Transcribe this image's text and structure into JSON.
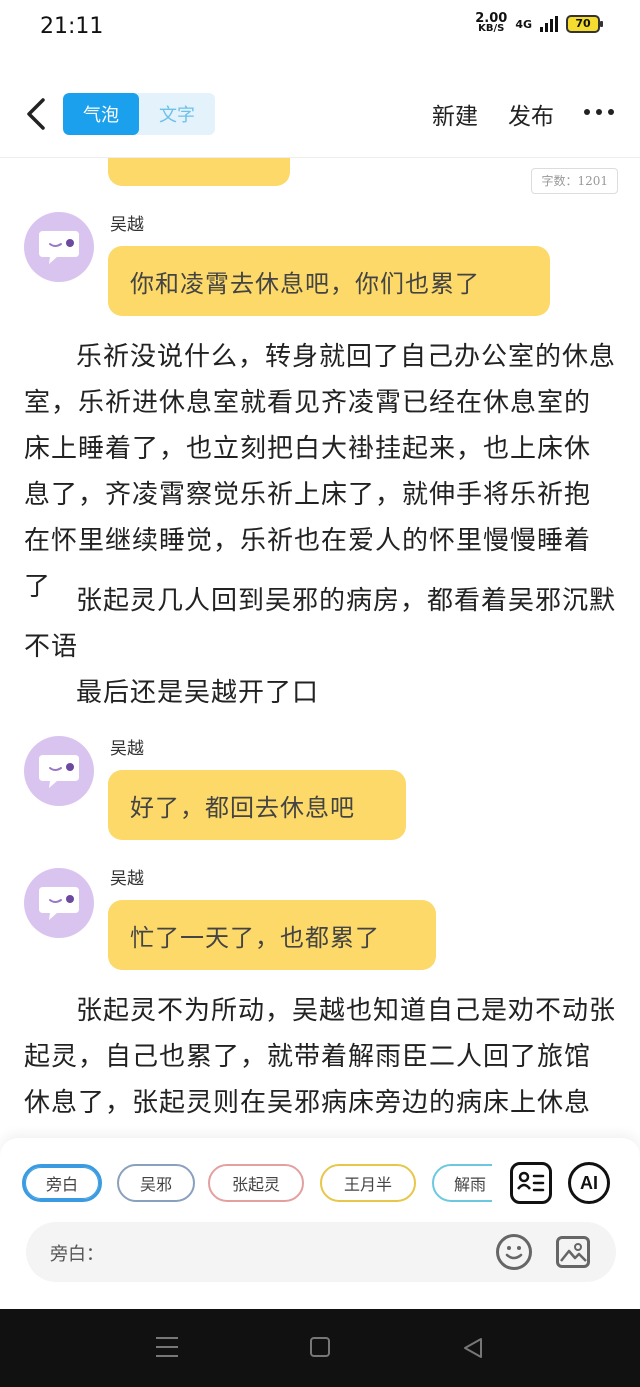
{
  "status_bar": {
    "time": "21:11",
    "net_speed_value": "2.00",
    "net_speed_unit": "KB/S",
    "network_type": "4G",
    "battery": "70"
  },
  "nav": {
    "modes": [
      "气泡",
      "文字"
    ],
    "active_mode": "气泡",
    "new_label": "新建",
    "publish_label": "发布",
    "more_icon": "more-icon"
  },
  "word_count": "字数：1201",
  "messages": [
    {
      "speaker": "吴越",
      "text": "你和凌霄去休息吧，你们也累了"
    },
    {
      "speaker": "吴越",
      "text": "好了，都回去休息吧"
    },
    {
      "speaker": "吴越",
      "text": "忙了一天了，也都累了"
    }
  ],
  "narrations": [
    "乐祈没说什么，转身就回了自己办公室的休息室，乐祈进休息室就看见齐凌霄已经在休息室的床上睡着了，也立刻把白大褂挂起来，也上床休息了，齐凌霄察觉乐祈上床了，就伸手将乐祈抱在怀里继续睡觉，乐祈也在爱人的怀里慢慢睡着了",
    "张起灵几人回到吴邪的病房，都看着吴邪沉默不语",
    "最后还是吴越开了口",
    "张起灵不为所动，吴越也知道自己是劝不动张起灵，自己也累了，就带着解雨臣二人回了旅馆休息了，张起灵则在吴邪病床旁边的病床上休息"
  ],
  "characters": [
    {
      "name": "旁白",
      "color": "#3a9be0",
      "selected": true
    },
    {
      "name": "吴邪",
      "color": "#8aa0bf",
      "selected": false
    },
    {
      "name": "张起灵",
      "color": "#e4a0a0",
      "selected": false
    },
    {
      "name": "王月半",
      "color": "#e8c64a",
      "selected": false
    },
    {
      "name": "解雨",
      "color": "#6cc8e0",
      "selected": false
    }
  ],
  "input": {
    "label": "旁白："
  },
  "colors": {
    "bubble": "#fcd968",
    "avatar": "#d9c4f0",
    "accent": "#1aa0ec"
  }
}
